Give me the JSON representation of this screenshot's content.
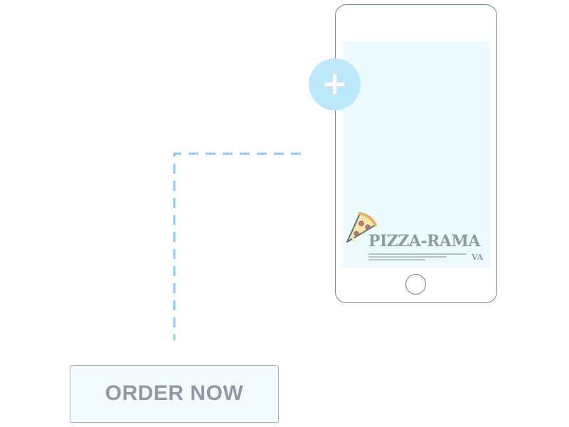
{
  "add_button": {
    "symbol": "+"
  },
  "logo": {
    "name": "PIZZA-RAMA",
    "subtitle": "VA"
  },
  "order_button": {
    "label": "ORDER NOW"
  },
  "icons": {
    "add": "plus-icon",
    "logo": "pizza-slice-icon",
    "device": "smartphone"
  },
  "colors": {
    "accent_light_blue": "#bde7fb",
    "screen_fill": "#ecfafd",
    "dashed_connector": "#89cdee",
    "outline": "#6f8497",
    "text_gray": "#8d9ba8"
  }
}
